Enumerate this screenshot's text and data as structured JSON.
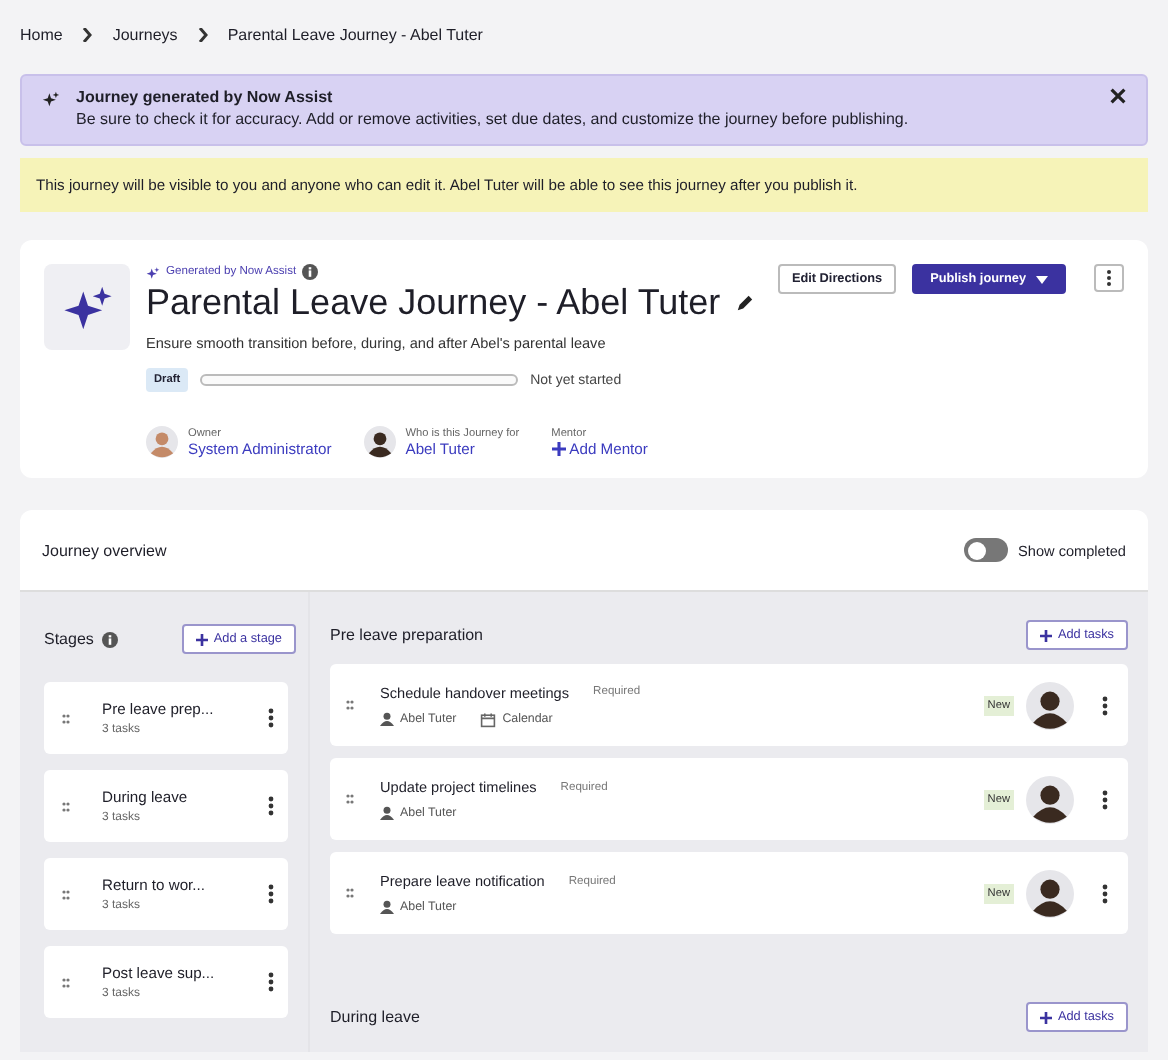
{
  "breadcrumb": [
    {
      "label": "Home"
    },
    {
      "label": "Journeys"
    },
    {
      "label": "Parental Leave Journey - Abel Tuter"
    }
  ],
  "ai_banner": {
    "title": "Journey generated by Now Assist",
    "message": "Be sure to check it for accuracy. Add or remove activities, set due dates, and customize the journey before publishing."
  },
  "visibility_notice": "This journey will be visible to you and anyone who can edit it. Abel Tuter will be able to see this journey after you publish it.",
  "header": {
    "generated_label": "Generated by Now Assist",
    "title": "Parental Leave Journey - Abel Tuter",
    "description": "Ensure smooth transition before, during, and after Abel's parental leave",
    "status": "Draft",
    "level": 0,
    "progress_text": "Not yet started",
    "edit_button": "Edit Directions",
    "publish_button": "Publish journey",
    "people": [
      {
        "label": "Owner",
        "name": "System Administrator",
        "kind": "person"
      },
      {
        "label": "Who is this Journey for",
        "name": "Abel Tuter",
        "kind": "person"
      },
      {
        "label": "Mentor",
        "name": "Add Mentor",
        "kind": "add"
      }
    ]
  },
  "overview": {
    "title": "Journey overview",
    "toggle": {
      "label": "Show completed",
      "on": false
    }
  },
  "stages": {
    "title": "Stages",
    "add_button": "Add a stage",
    "items": [
      {
        "name": "Pre leave prep...",
        "count": "3 tasks"
      },
      {
        "name": "During leave",
        "count": "3 tasks"
      },
      {
        "name": "Return to wor...",
        "count": "3 tasks"
      },
      {
        "name": "Post leave sup...",
        "count": "3 tasks"
      }
    ]
  },
  "sections": [
    {
      "title": "Pre leave preparation",
      "add_button": "Add tasks",
      "tasks": [
        {
          "title": "Schedule handover meetings",
          "tag": "Required",
          "assignee": "Abel Tuter",
          "tool": "Calendar",
          "status": "New"
        },
        {
          "title": "Update project timelines",
          "tag": "Required",
          "assignee": "Abel Tuter",
          "status": "New"
        },
        {
          "title": "Prepare leave notification",
          "tag": "Required",
          "assignee": "Abel Tuter",
          "status": "New"
        }
      ]
    },
    {
      "title": "During leave",
      "add_button": "Add tasks"
    }
  ]
}
